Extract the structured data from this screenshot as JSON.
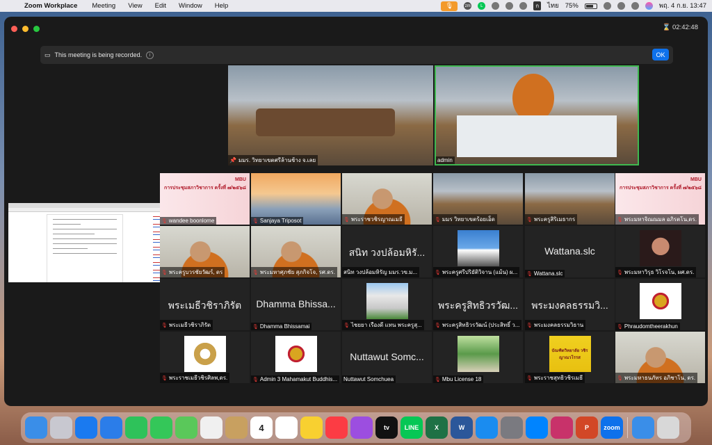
{
  "menubar": {
    "app_name": "Zoom Workplace",
    "menus": [
      "Meeting",
      "View",
      "Edit",
      "Window",
      "Help"
    ],
    "status": {
      "lang": "ไทย",
      "battery": "75%",
      "datetime": "พฤ. 4 ก.ย.  13:47"
    }
  },
  "meeting": {
    "timer": "02:42:48",
    "banner": {
      "text": "This meeting is being recorded.",
      "ok_label": "OK"
    },
    "top_tiles": [
      {
        "name": "มมร. วิทยาเขตศรีล้านช้าง จ.เลย",
        "pinned": true
      },
      {
        "name": "admin",
        "active_speaker": true
      }
    ],
    "grid": [
      {
        "name": "wandee boonlome",
        "kind": "doc"
      },
      {
        "name": "Sanjaya Triposot",
        "kind": "bridge"
      },
      {
        "name": "พระราชวชิรญาณเมธี",
        "kind": "person"
      },
      {
        "name": "มมร วิทยาเขตร้อยเอ็ด",
        "kind": "room"
      },
      {
        "name": "พระครูสิริเมธากร",
        "kind": "room"
      },
      {
        "name": "พระมหาจิณณมล อภิรตโน,ดร.",
        "kind": "doc"
      },
      {
        "name": "พระครูบวรชัยวัฒร์, ดร",
        "kind": "person"
      },
      {
        "name": "พระมหาศุภชัย สุภกิจโจ, รศ.ดร.",
        "kind": "person"
      },
      {
        "name": "สนิท  วงปล้อมหิรัญ มมร.วข.ม...",
        "big": "สนิท  วงปล้อมหิรั...",
        "kind": "text"
      },
      {
        "name": "พระครูศรีปริยัติวิจาน (แม้น) ผ...",
        "kind": "mountain"
      },
      {
        "name": "Wattana.slc",
        "big": "Wattana.slc",
        "kind": "text"
      },
      {
        "name": "พระมหาวิรุธ วิโรจโน, ผศ.ดร.",
        "kind": "statue"
      },
      {
        "name": "พระเมธีวชิราภิรัต",
        "big": "พระเมธีวชิราภิรัต",
        "kind": "text"
      },
      {
        "name": "Dhamma Bhissamai",
        "big": "Dhamma Bhissa...",
        "kind": "text"
      },
      {
        "name": "ไชยยา  เรืองดี  แทน  พระครูสุ...",
        "kind": "building"
      },
      {
        "name": "พระครูสิทธิวรวัฒน์ (ประสิทธิ์ ว...",
        "big": "พระครูสิทธิวรวัฒ...",
        "kind": "text"
      },
      {
        "name": "พระมงคลธรรมวิธาน",
        "big": "พระมงคลธรรมวิ...",
        "kind": "text"
      },
      {
        "name": "Phraudomtheerakhun",
        "kind": "emblem"
      },
      {
        "name": "พระราชเมธีวชิรศิลพ,ดร.",
        "kind": "seal"
      },
      {
        "name": "Admin 3 Mahamakut Buddhis...",
        "kind": "emblem"
      },
      {
        "name": "Nuttawut Somchuea",
        "big": "Nuttawut Somc...",
        "kind": "text"
      },
      {
        "name": "Mbu License 18",
        "kind": "trees"
      },
      {
        "name": "พระราชสุทธิวชิรเมธี",
        "kind": "logo"
      },
      {
        "name": "พระมหาธนภัทร อภิชาโน, ดร.",
        "kind": "person"
      }
    ],
    "doc_title": "การประชุมสภาวิชาการ ครั้งที่ ๗/๒๕๖๘",
    "doc_brand": "MBU",
    "logo_text": "บัณฑิตวิทยาลัย วชิรญาณวโรรส"
  },
  "dock": [
    "Finder",
    "Launchpad",
    "Safari",
    "Mail",
    "FaceTime",
    "Messages",
    "Maps",
    "Photos",
    "Contacts",
    "Calendar",
    "Reminders",
    "Notes",
    "Music",
    "Podcasts",
    "TV",
    "LINE",
    "Excel",
    "Word",
    "App Store",
    "System Settings",
    "Messenger",
    "Feedback",
    "PowerPoint",
    "Zoom",
    "Downloads",
    "Trash"
  ],
  "dock_calendar": {
    "month": "ก.ย.",
    "day": "4"
  },
  "colors": {
    "zoom_blue": "#0e71eb",
    "active_speaker": "#3fb950",
    "muted": "#e53935"
  }
}
